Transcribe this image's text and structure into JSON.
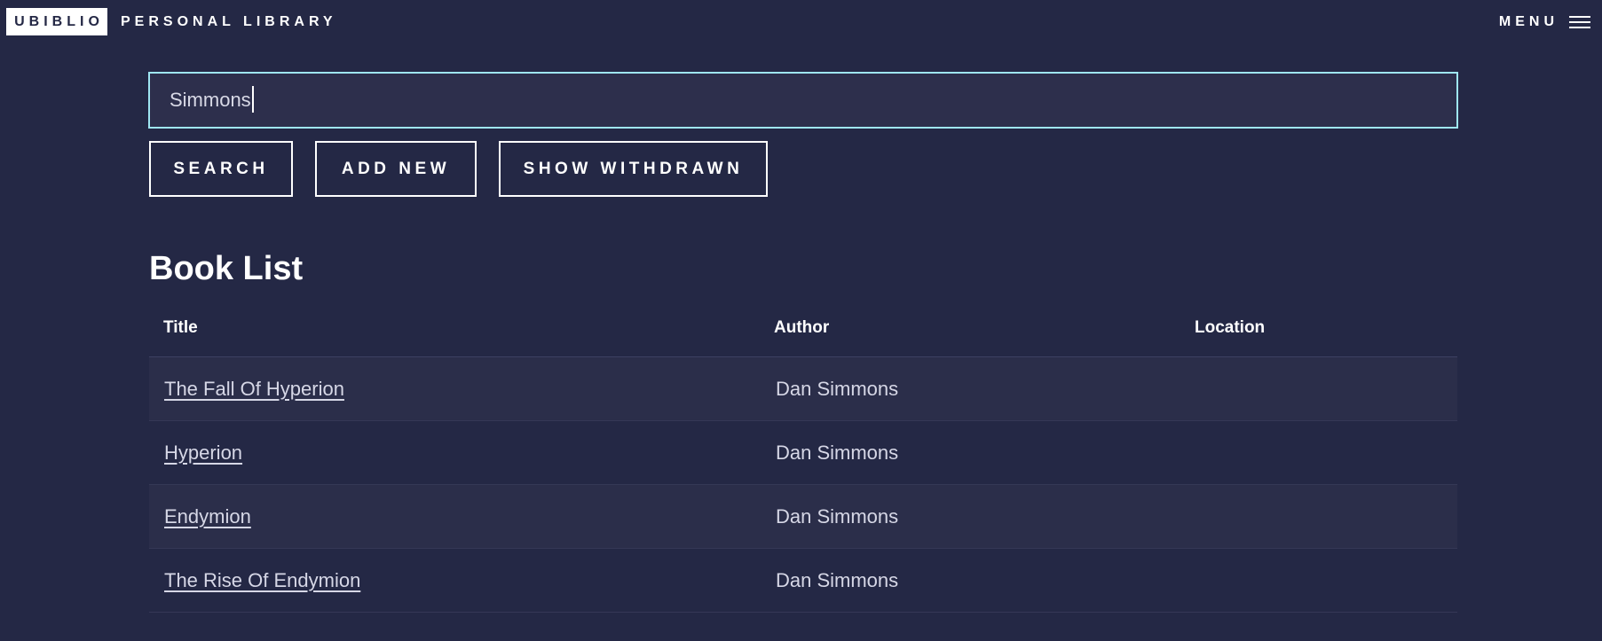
{
  "header": {
    "logo": "UBIBLIO",
    "subtitle": "PERSONAL LIBRARY",
    "menu_label": "MENU"
  },
  "search": {
    "value": "Simmons",
    "placeholder": ""
  },
  "buttons": {
    "search": "SEARCH",
    "add_new": "ADD NEW",
    "show_withdrawn": "SHOW WITHDRAWN"
  },
  "book_list": {
    "heading": "Book List",
    "columns": [
      "Title",
      "Author",
      "Location"
    ],
    "rows": [
      {
        "title": "The Fall Of Hyperion",
        "author": "Dan Simmons",
        "location": ""
      },
      {
        "title": "Hyperion",
        "author": "Dan Simmons",
        "location": ""
      },
      {
        "title": "Endymion",
        "author": "Dan Simmons",
        "location": ""
      },
      {
        "title": "The Rise Of Endymion",
        "author": "Dan Simmons",
        "location": ""
      }
    ]
  },
  "colors": {
    "background": "#242845",
    "row_alt": "#2b2e4a",
    "input_border": "#9fe6f2"
  }
}
